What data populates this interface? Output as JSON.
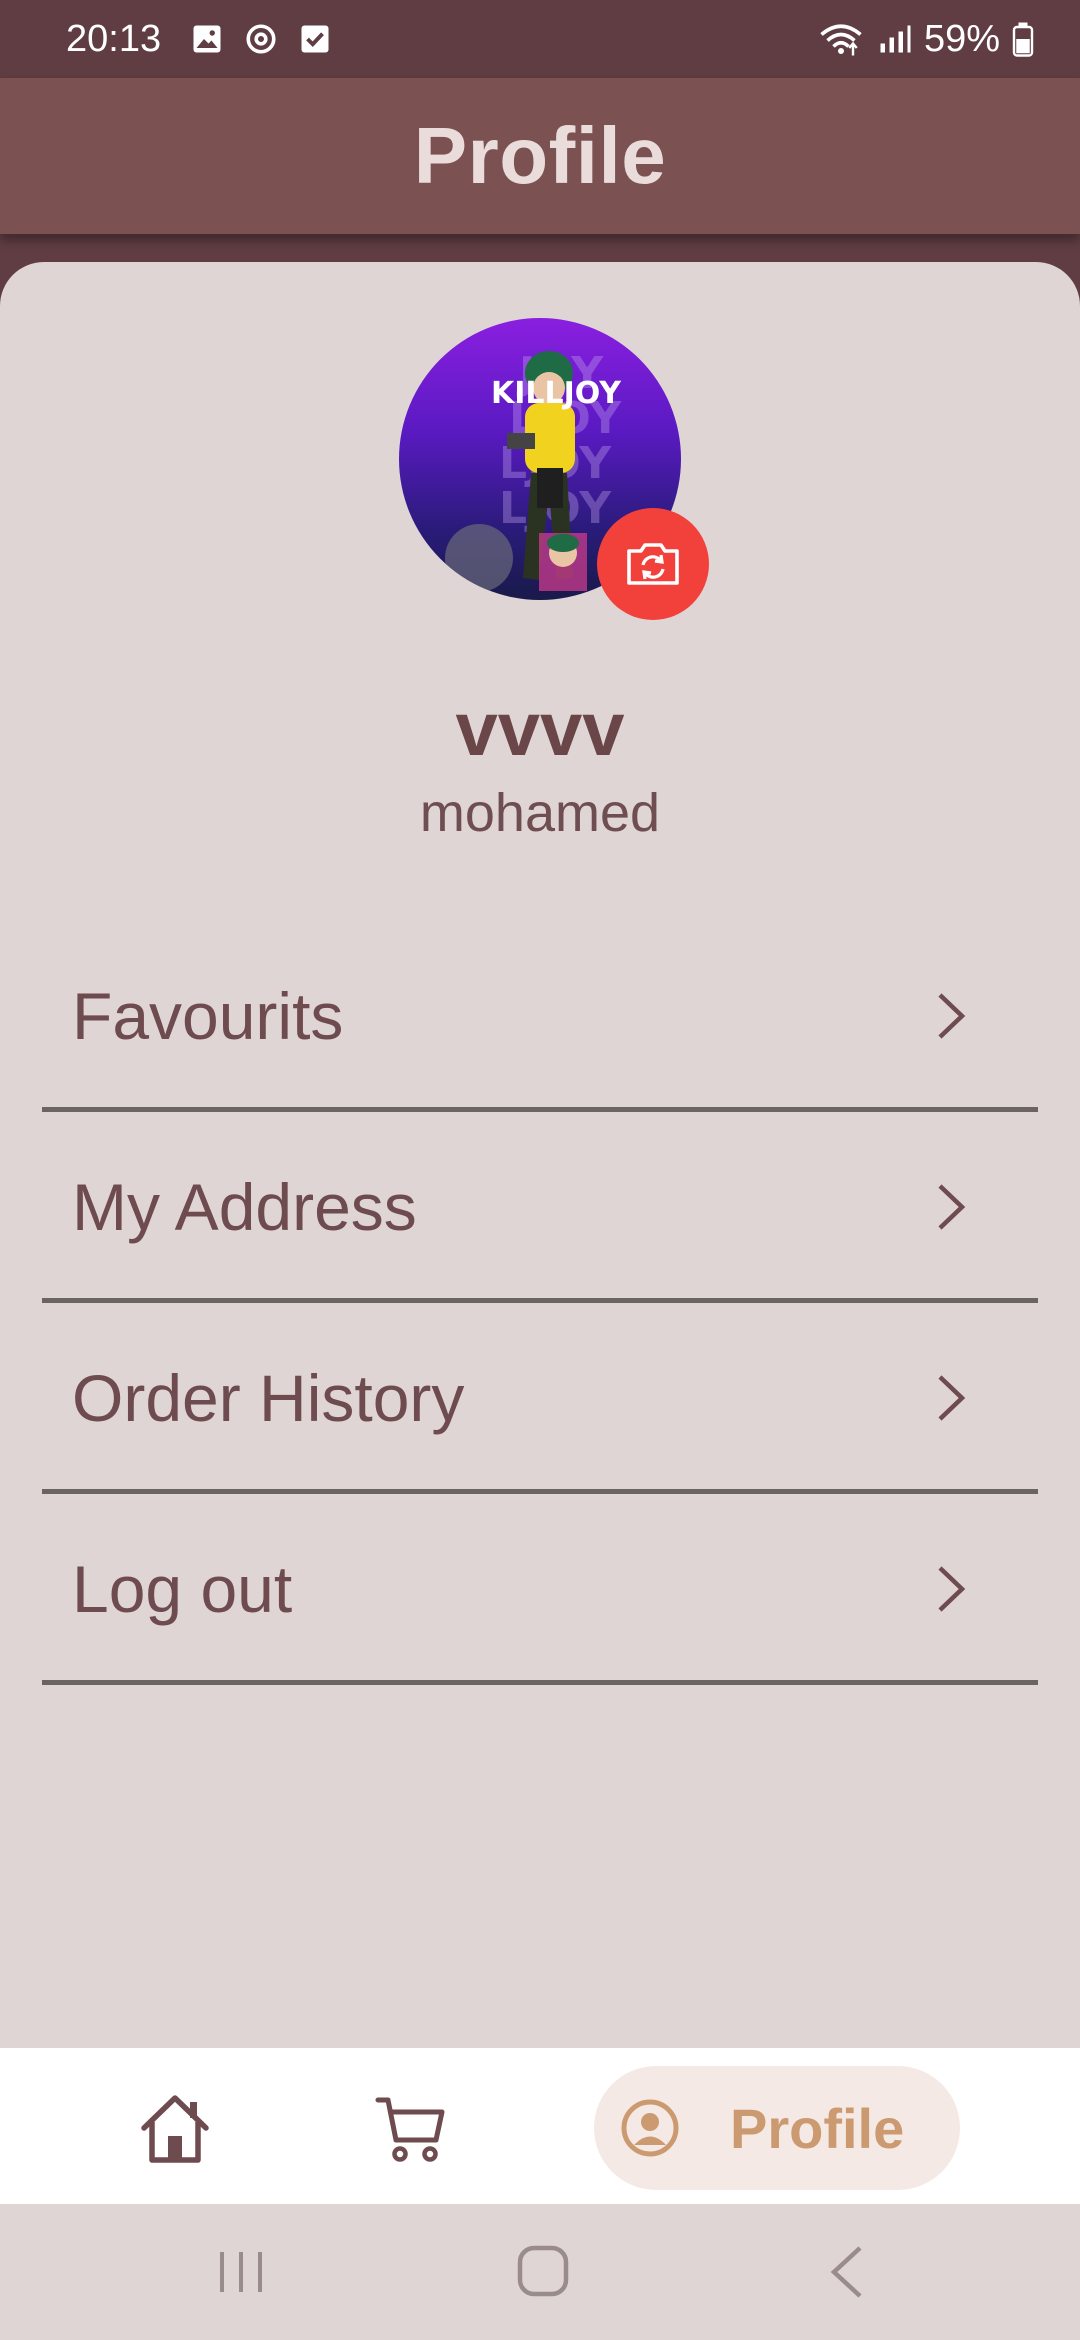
{
  "status_bar": {
    "time": "20:13",
    "battery": "59%",
    "icons": [
      "image-icon",
      "sync-icon",
      "checkbox-icon",
      "wifi-icon",
      "signal-icon",
      "battery-icon"
    ]
  },
  "app_bar": {
    "title": "Profile"
  },
  "profile": {
    "avatar_text": "KILLJOY",
    "name": "vvvv",
    "subtitle": "mohamed"
  },
  "menu": {
    "items": [
      {
        "label": "Favourits",
        "icon": "chevron-right-icon"
      },
      {
        "label": "My Address",
        "icon": "chevron-right-icon"
      },
      {
        "label": "Order History",
        "icon": "chevron-right-icon"
      },
      {
        "label": "Log out",
        "icon": "chevron-right-icon"
      }
    ]
  },
  "bottom_nav": {
    "items": [
      {
        "icon": "home-icon"
      },
      {
        "icon": "cart-icon"
      },
      {
        "icon": "profile-icon",
        "label": "Profile",
        "selected": true
      }
    ]
  },
  "colors": {
    "status_bar": "#5f3d42",
    "app_bar": "#7b5151",
    "background": "#e0d5d5",
    "text_primary": "#6e4b4e",
    "camera_button": "#f2413b",
    "nav_selected_bg": "#f4e9e4",
    "nav_selected_text": "#cc9a70"
  }
}
